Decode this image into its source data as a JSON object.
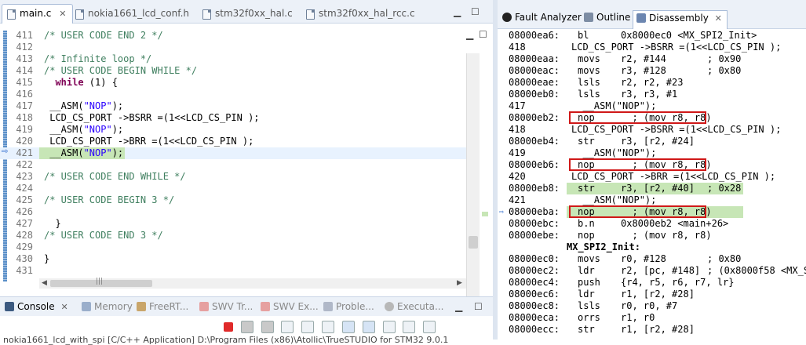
{
  "editor": {
    "tabs": [
      {
        "label": "main.c",
        "active": true
      },
      {
        "label": "nokia1661_lcd_conf.h",
        "active": false
      },
      {
        "label": "stm32f0xx_hal.c",
        "active": false
      },
      {
        "label": "stm32f0xx_hal_rcc.c",
        "active": false
      }
    ],
    "lines": [
      {
        "n": "411",
        "text": "/* USER CODE END 2 */"
      },
      {
        "n": "412",
        "text": ""
      },
      {
        "n": "413",
        "text": "/* Infinite loop */"
      },
      {
        "n": "414",
        "text": "/* USER CODE BEGIN WHILE */"
      },
      {
        "n": "415",
        "text": "  while (1) {"
      },
      {
        "n": "416",
        "text": ""
      },
      {
        "n": "417",
        "text": " __ASM(\"NOP\");"
      },
      {
        "n": "418",
        "text": " LCD_CS_PORT ->BSRR =(1<<LCD_CS_PIN );"
      },
      {
        "n": "419",
        "text": " __ASM(\"NOP\");"
      },
      {
        "n": "420",
        "text": " LCD_CS_PORT ->BRR =(1<<LCD_CS_PIN );"
      },
      {
        "n": "421",
        "text": " __ASM(\"NOP\");"
      },
      {
        "n": "422",
        "text": ""
      },
      {
        "n": "423",
        "text": "/* USER CODE END WHILE */"
      },
      {
        "n": "424",
        "text": ""
      },
      {
        "n": "425",
        "text": "/* USER CODE BEGIN 3 */"
      },
      {
        "n": "426",
        "text": ""
      },
      {
        "n": "427",
        "text": "  }"
      },
      {
        "n": "428",
        "text": "/* USER CODE END 3 */"
      },
      {
        "n": "429",
        "text": ""
      },
      {
        "n": "430",
        "text": "}"
      },
      {
        "n": "431",
        "text": ""
      }
    ],
    "scroll_arrow_left": "◀",
    "scroll_arrow_right": "▶",
    "scroll_grip": "|||"
  },
  "console": {
    "tabs": [
      {
        "label": "Console",
        "active": true
      },
      {
        "label": "Memory",
        "active": false
      },
      {
        "label": "FreeRT...",
        "active": false
      },
      {
        "label": "SWV Tr...",
        "active": false
      },
      {
        "label": "SWV Ex...",
        "active": false
      },
      {
        "label": "Proble...",
        "active": false
      },
      {
        "label": "Executa...",
        "active": false
      }
    ],
    "status_line": "nokia1661_lcd_with_spi [C/C++ Application] D:\\Program Files (x86)\\Atollic\\TrueSTUDIO for STM32 9.0.1"
  },
  "disassembly": {
    "tabs": [
      {
        "label": "Fault Analyzer",
        "active": false
      },
      {
        "label": "Outline",
        "active": false
      },
      {
        "label": "Disassembly",
        "active": true
      }
    ],
    "rows": [
      {
        "kind": "asm",
        "addr": "08000ea6:",
        "mn": "bl",
        "ops": "0x8000ec0 <MX_SPI2_Init>",
        "cmt": ""
      },
      {
        "kind": "src",
        "n": "418",
        "text": "LCD_CS_PORT ->BSRR =(1<<LCD_CS_PIN );"
      },
      {
        "kind": "asm",
        "addr": "08000eaa:",
        "mn": "movs",
        "ops": "r2, #144",
        "cmt": "; 0x90"
      },
      {
        "kind": "asm",
        "addr": "08000eac:",
        "mn": "movs",
        "ops": "r3, #128",
        "cmt": "; 0x80"
      },
      {
        "kind": "asm",
        "addr": "08000eae:",
        "mn": "lsls",
        "ops": "r2, r2, #23",
        "cmt": ""
      },
      {
        "kind": "asm",
        "addr": "08000eb0:",
        "mn": "lsls",
        "ops": "r3, r3, #1",
        "cmt": ""
      },
      {
        "kind": "src",
        "n": "417",
        "text": "  __ASM(\"NOP\");"
      },
      {
        "kind": "asm",
        "addr": "08000eb2:",
        "mn": "nop",
        "ops": "  ; (mov r8, r8)",
        "cmt": "",
        "boxed": true
      },
      {
        "kind": "src",
        "n": "418",
        "text": "LCD_CS_PORT ->BSRR =(1<<LCD_CS_PIN );"
      },
      {
        "kind": "asm",
        "addr": "08000eb4:",
        "mn": "str",
        "ops": "r3, [r2, #24]",
        "cmt": ""
      },
      {
        "kind": "src",
        "n": "419",
        "text": "  __ASM(\"NOP\");"
      },
      {
        "kind": "asm",
        "addr": "08000eb6:",
        "mn": "nop",
        "ops": "  ; (mov r8, r8)",
        "cmt": "",
        "boxed": true
      },
      {
        "kind": "src",
        "n": "420",
        "text": "LCD_CS_PORT ->BRR =(1<<LCD_CS_PIN );"
      },
      {
        "kind": "asm",
        "addr": "08000eb8:",
        "mn": "str",
        "ops": "r3, [r2, #40]",
        "cmt": "; 0x28",
        "selected": true
      },
      {
        "kind": "src",
        "n": "421",
        "text": "  __ASM(\"NOP\");"
      },
      {
        "kind": "asm",
        "addr": "08000eba:",
        "mn": "nop",
        "ops": "  ; (mov r8, r8)",
        "cmt": "",
        "boxed": true,
        "selected": true,
        "current": true
      },
      {
        "kind": "asm",
        "addr": "08000ebc:",
        "mn": "b.n",
        "ops": "0x8000eb2 <main+26>",
        "cmt": ""
      },
      {
        "kind": "asm",
        "addr": "08000ebe:",
        "mn": "nop",
        "ops": "  ; (mov r8, r8)",
        "cmt": ""
      },
      {
        "kind": "label",
        "text": "MX_SPI2_Init:"
      },
      {
        "kind": "asm",
        "addr": "08000ec0:",
        "mn": "movs",
        "ops": "r0, #128",
        "cmt": "; 0x80"
      },
      {
        "kind": "asm",
        "addr": "08000ec2:",
        "mn": "ldr",
        "ops": "r2, [pc, #148]",
        "cmt": "; (0x8000f58 <MX_S"
      },
      {
        "kind": "asm",
        "addr": "08000ec4:",
        "mn": "push",
        "ops": "{r4, r5, r6, r7, lr}",
        "cmt": ""
      },
      {
        "kind": "asm",
        "addr": "08000ec6:",
        "mn": "ldr",
        "ops": "r1, [r2, #28]",
        "cmt": ""
      },
      {
        "kind": "asm",
        "addr": "08000ec8:",
        "mn": "lsls",
        "ops": "r0, r0, #7",
        "cmt": ""
      },
      {
        "kind": "asm",
        "addr": "08000eca:",
        "mn": "orrs",
        "ops": "r1, r0",
        "cmt": ""
      },
      {
        "kind": "asm",
        "addr": "08000ecc:",
        "mn": "str",
        "ops": "r1, [r2, #28]",
        "cmt": ""
      }
    ]
  },
  "colors": {
    "comment": "#3f7f5f",
    "keyword": "#7f0055",
    "string": "#2a00ff",
    "highlight_box": "#d01818",
    "selection": "#c7e6b6"
  }
}
